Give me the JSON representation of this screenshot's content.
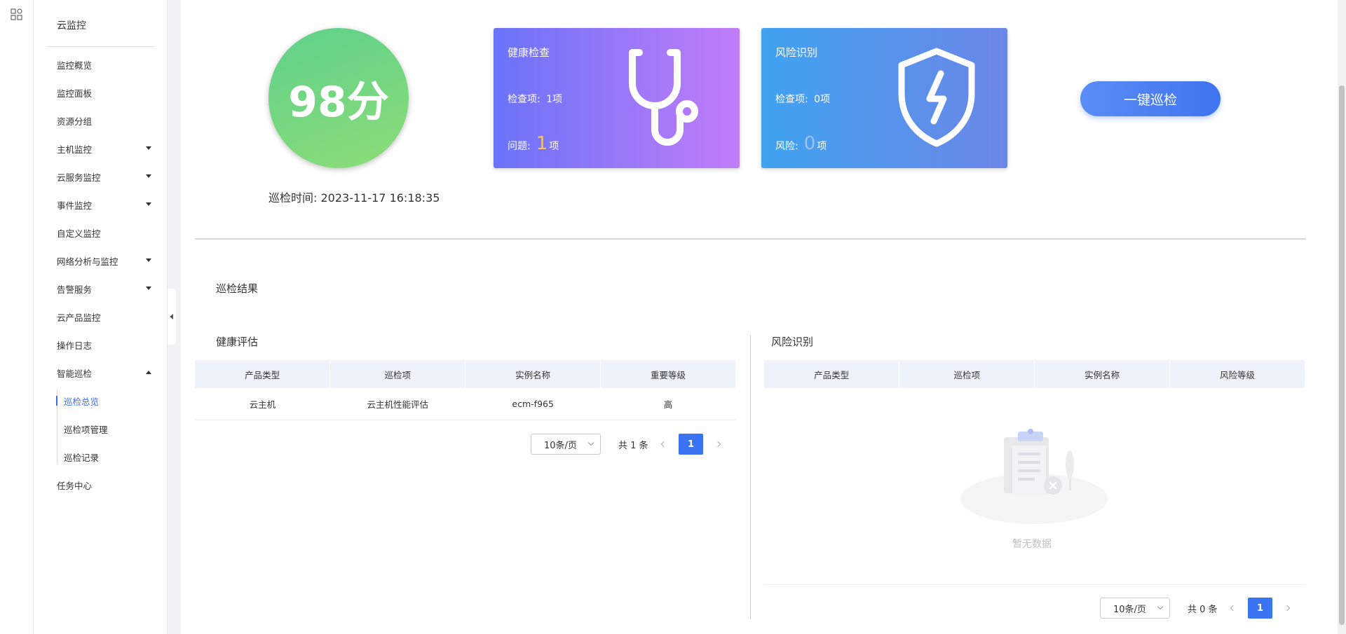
{
  "rail": {
    "icon": "apps-grid-icon"
  },
  "sidebar": {
    "title": "云监控",
    "items": [
      {
        "label": "监控概览",
        "caret": ""
      },
      {
        "label": "监控面板",
        "caret": ""
      },
      {
        "label": "资源分组",
        "caret": ""
      },
      {
        "label": "主机监控",
        "caret": "down"
      },
      {
        "label": "云服务监控",
        "caret": "down"
      },
      {
        "label": "事件监控",
        "caret": "down"
      },
      {
        "label": "自定义监控",
        "caret": ""
      },
      {
        "label": "网络分析与监控",
        "caret": "down"
      },
      {
        "label": "告警服务",
        "caret": "down"
      },
      {
        "label": "云产品监控",
        "caret": ""
      },
      {
        "label": "操作日志",
        "caret": ""
      },
      {
        "label": "智能巡检",
        "caret": "up"
      }
    ],
    "subitems": [
      {
        "label": "巡检总览",
        "active": true
      },
      {
        "label": "巡检项管理",
        "active": false
      },
      {
        "label": "巡检记录",
        "active": false
      }
    ],
    "last_item": "任务中心"
  },
  "score": {
    "value": "98分"
  },
  "inspect_time": {
    "label": "巡检时间:",
    "value": "2023-11-17 16:18:35"
  },
  "health_card": {
    "title": "健康检查",
    "check_label": "检查项:",
    "check_value": "1项",
    "issue_label": "问题:",
    "issue_count": "1",
    "issue_unit": "项",
    "icon": "stethoscope-icon"
  },
  "risk_card": {
    "title": "风险识别",
    "check_label": "检查项:",
    "check_value": "0项",
    "risk_label": "风险:",
    "risk_count": "0",
    "risk_unit": "项",
    "icon": "shield-lightning-icon"
  },
  "oneclick_button": "一键巡检",
  "results": {
    "title": "巡检结果",
    "health": {
      "title": "健康评估",
      "columns": [
        "产品类型",
        "巡检项",
        "实例名称",
        "重要等级"
      ],
      "rows": [
        [
          "云主机",
          "云主机性能评估",
          "ecm-f965",
          "高"
        ]
      ],
      "pager": {
        "page_size": "10条/页",
        "total": "共 1 条",
        "page": "1"
      }
    },
    "risk": {
      "title": "风险识别",
      "columns": [
        "产品类型",
        "巡检项",
        "实例名称",
        "风险等级"
      ],
      "empty_text": "暂无数据",
      "pager": {
        "page_size": "10条/页",
        "total": "共 0 条",
        "page": "1"
      }
    }
  },
  "colors": {
    "accent": "#3b74f1",
    "score_green": "#5fd18a",
    "health_start": "#6a73f8",
    "health_end": "#c27cf9",
    "risk_start": "#3fa2f0",
    "risk_end": "#6c86e8",
    "header_bg": "#eef2fb"
  }
}
